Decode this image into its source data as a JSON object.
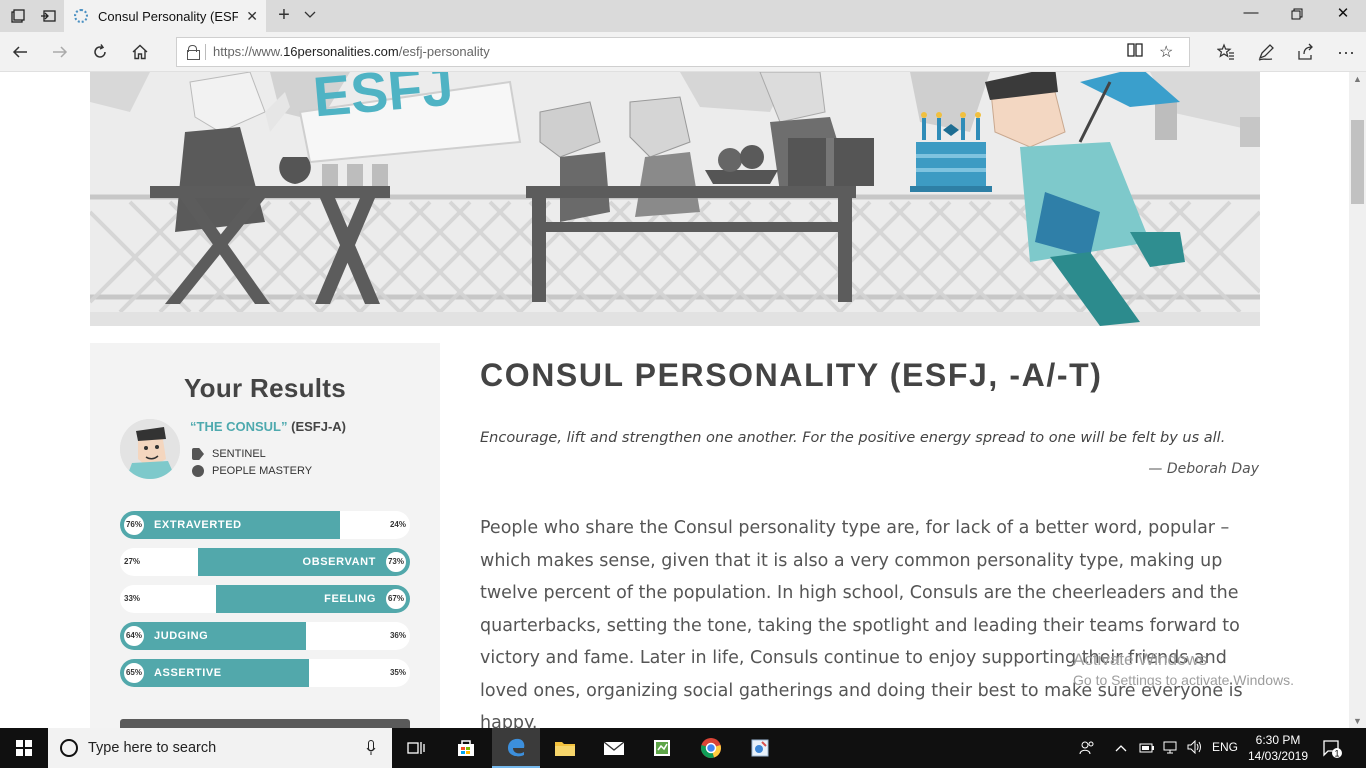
{
  "browser": {
    "tab_title": "Consul Personality (ESFJ",
    "url_prefix": "https://www.",
    "url_domain": "16personalities.com",
    "url_path": "/esfj-personality"
  },
  "hero": {
    "sign_text": "ESFJ"
  },
  "sidebar": {
    "heading": "Your Results",
    "type_quote": "“THE CONSUL”",
    "type_code": "(ESFJ-A)",
    "role": "SENTINEL",
    "strategy": "PEOPLE MASTERY",
    "traits": [
      {
        "label": "EXTRAVERTED",
        "percent": "76%",
        "other_percent": "24%",
        "value": 0.76,
        "side": "left"
      },
      {
        "label": "OBSERVANT",
        "percent": "73%",
        "other_percent": "27%",
        "value": 0.73,
        "side": "right"
      },
      {
        "label": "FEELING",
        "percent": "67%",
        "other_percent": "33%",
        "value": 0.67,
        "side": "right"
      },
      {
        "label": "JUDGING",
        "percent": "64%",
        "other_percent": "36%",
        "value": 0.64,
        "side": "left"
      },
      {
        "label": "ASSERTIVE",
        "percent": "65%",
        "other_percent": "35%",
        "value": 0.65,
        "side": "left"
      }
    ]
  },
  "article": {
    "title": "CONSUL PERSONALITY (ESFJ, -A/-T)",
    "quote": "Encourage, lift and strengthen one another. For the positive energy spread to one will be felt by us all.",
    "author": "— Deborah Day",
    "paragraph": "People who share the Consul personality type are, for lack of a better word, popular – which makes sense, given that it is also a very common personality type, making up twelve percent of the population. In high school, Consuls are the cheerleaders and the quarterbacks, setting the tone, taking the spotlight and leading their teams forward to victory and fame. Later in life, Consuls continue to enjoy supporting their friends and loved ones, organizing social gatherings and doing their best to make sure everyone is happy."
  },
  "watermark": {
    "line1": "Activate Windows",
    "line2": "Go to Settings to activate Windows."
  },
  "taskbar": {
    "search_placeholder": "Type here to search",
    "language": "ENG",
    "time": "6:30 PM",
    "date": "14/03/2019",
    "notification_count": "1"
  },
  "colors": {
    "accent_teal": "#52a8ab",
    "sidebar_bg": "#f3f3f3",
    "title_gray": "#444444"
  }
}
